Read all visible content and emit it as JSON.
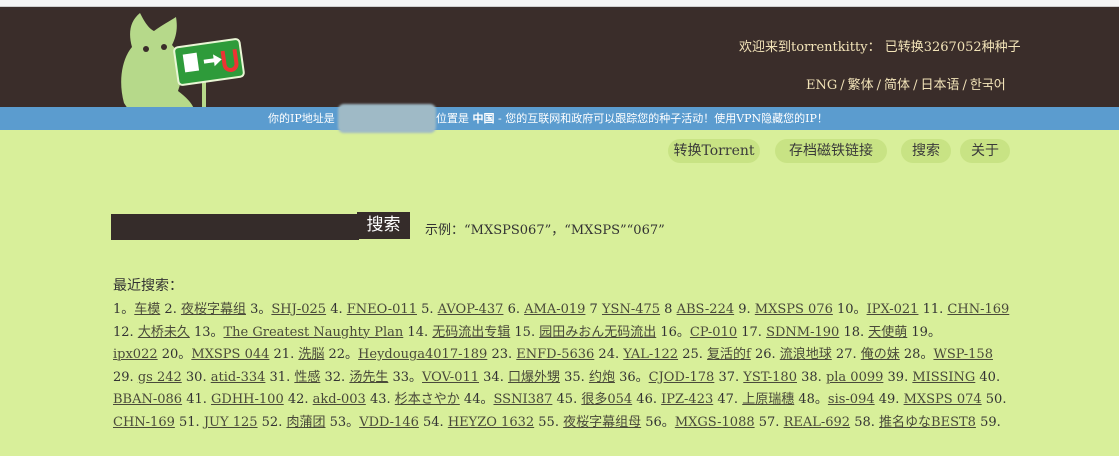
{
  "header": {
    "welcome": "欢迎来到torrentkitty： 已转换3267052种种子",
    "languages": [
      "ENG",
      "繁体",
      "简体",
      "日本语",
      "한국어"
    ]
  },
  "notice": {
    "prefix": "你的IP地址是",
    "location_label": "位置是",
    "location": "中国",
    "message": " - 您的互联网和政府可以跟踪您的种子活动！使用VPN隐藏您的IP！"
  },
  "nav": [
    "转换Torrent",
    "存档磁铁链接",
    "搜索",
    "关于"
  ],
  "search": {
    "button": "搜索",
    "example": "示例：“MXSPS067”，“MXSPS”“067”"
  },
  "recent": {
    "title": "最近搜索：",
    "rows": [
      [
        [
          "1。",
          "车模"
        ],
        [
          " 2. ",
          "夜桜字幕组"
        ],
        [
          " 3。",
          "SHJ-025"
        ],
        [
          " 4. ",
          "FNEO-011"
        ],
        [
          " 5. ",
          "AVOP-437"
        ],
        [
          " 6. ",
          "AMA-019"
        ],
        [
          " 7 ",
          "YSN-475"
        ],
        [
          " 8 ",
          "ABS-224"
        ],
        [
          " 9. ",
          "MXSPS 076"
        ],
        [
          " 10。",
          "IPX-021"
        ],
        [
          " 11. ",
          "CHN-169"
        ]
      ],
      [
        [
          "12. ",
          "大桥未久"
        ],
        [
          " 13。",
          "The Greatest Naughty Plan"
        ],
        [
          " 14. ",
          "无码流出专辑"
        ],
        [
          " 15. ",
          "园田みおん无码流出"
        ],
        [
          " 16。",
          "CP-010"
        ],
        [
          " 17. ",
          "SDNM-190"
        ],
        [
          " 18. ",
          "天使萌"
        ],
        [
          " 19。",
          ""
        ]
      ],
      [
        [
          "",
          "ipx022"
        ],
        [
          " 20。",
          "MXSPS 044"
        ],
        [
          " 21. ",
          "洗脳"
        ],
        [
          " 22。",
          "Heydouga4017-189"
        ],
        [
          " 23. ",
          "ENFD-5636"
        ],
        [
          " 24. ",
          "YAL-122"
        ],
        [
          " 25. ",
          "复活的f"
        ],
        [
          " 26. ",
          "流浪地球"
        ],
        [
          " 27. ",
          "俺の妹"
        ],
        [
          " 28。",
          "WSP-158"
        ]
      ],
      [
        [
          "29. ",
          "gs 242"
        ],
        [
          " 30. ",
          "atid-334"
        ],
        [
          " 31. ",
          "性感"
        ],
        [
          " 32. ",
          "汤先生"
        ],
        [
          " 33。",
          "VOV-011"
        ],
        [
          " 34. ",
          "口爆外甥"
        ],
        [
          " 35. ",
          "约炮"
        ],
        [
          " 36。",
          "CJOD-178"
        ],
        [
          " 37. ",
          "YST-180"
        ],
        [
          " 38. ",
          "pla 0099"
        ],
        [
          " 39. ",
          "MISSING"
        ],
        [
          " 40.",
          ""
        ]
      ],
      [
        [
          "",
          "BBAN-086"
        ],
        [
          " 41. ",
          "GDHH-100"
        ],
        [
          " 42. ",
          "akd-003"
        ],
        [
          " 43. ",
          "杉本さやか"
        ],
        [
          " 44。",
          "SSNI387"
        ],
        [
          " 45. ",
          "很多054"
        ],
        [
          " 46. ",
          "IPZ-423"
        ],
        [
          " 47. ",
          "上原瑞穗"
        ],
        [
          " 48。",
          "sis-094"
        ],
        [
          " 49. ",
          "MXSPS 074"
        ],
        [
          " 50.",
          ""
        ]
      ],
      [
        [
          "",
          "CHN-169"
        ],
        [
          " 51. ",
          "JUY 125"
        ],
        [
          " 52. ",
          "肉蒲团"
        ],
        [
          " 53。",
          "VDD-146"
        ],
        [
          " 54. ",
          "HEYZO 1632"
        ],
        [
          " 55. ",
          "夜桜字幕组母"
        ],
        [
          " 56。",
          "MXGS-1088"
        ],
        [
          " 57. ",
          "REAL-692"
        ],
        [
          " 58. ",
          "推名ゆなBEST8"
        ],
        [
          " 59.",
          ""
        ]
      ]
    ]
  }
}
